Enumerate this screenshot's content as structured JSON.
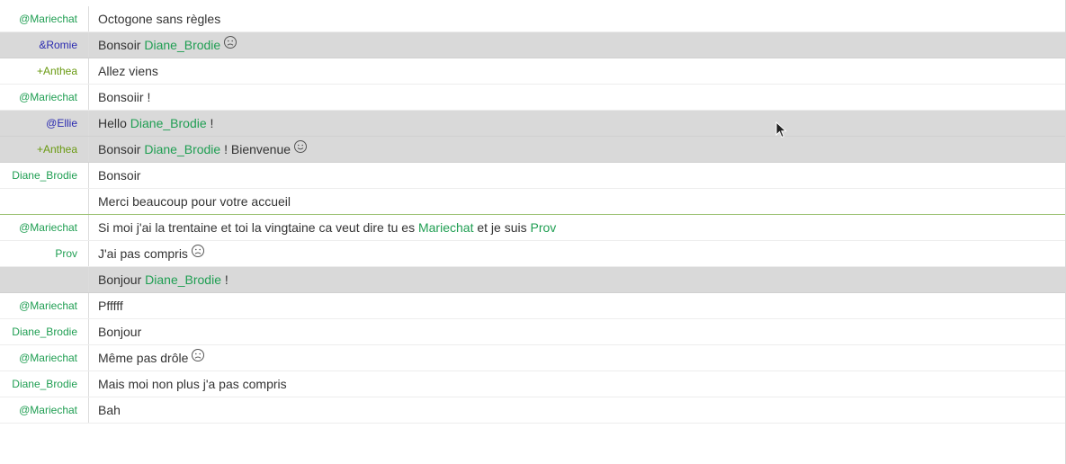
{
  "messages": [
    {
      "nick": "@Mariechat",
      "nick_color": "#1f9e52",
      "highlight": false,
      "parts": [
        {
          "t": "Octogone sans règles"
        }
      ]
    },
    {
      "nick": "&Romie",
      "nick_color": "#2a2ab0",
      "highlight": true,
      "parts": [
        {
          "t": "Bonsoir "
        },
        {
          "t": "Diane_Brodie",
          "hl": true
        }
      ],
      "smiley": "sad-smiley-icon"
    },
    {
      "nick": "+Anthea",
      "nick_color": "#6a9a12",
      "highlight": false,
      "parts": [
        {
          "t": "Allez viens"
        }
      ]
    },
    {
      "nick": "@Mariechat",
      "nick_color": "#1f9e52",
      "highlight": false,
      "parts": [
        {
          "t": "Bonsoiir !"
        }
      ]
    },
    {
      "nick": "@Ellie",
      "nick_color": "#2a2ab0",
      "highlight": true,
      "parts": [
        {
          "t": "Hello "
        },
        {
          "t": "Diane_Brodie",
          "hl": true
        },
        {
          "t": " !"
        }
      ]
    },
    {
      "nick": "+Anthea",
      "nick_color": "#6a9a12",
      "highlight": true,
      "parts": [
        {
          "t": "Bonsoir "
        },
        {
          "t": "Diane_Brodie",
          "hl": true
        },
        {
          "t": " ! Bienvenue"
        }
      ],
      "smiley": "happy-smiley-icon"
    },
    {
      "nick": "Diane_Brodie",
      "nick_color": "#1f9e52",
      "highlight": false,
      "parts": [
        {
          "t": "Bonsoir"
        }
      ]
    },
    {
      "nick": "",
      "nick_color": "#1f9e52",
      "highlight": false,
      "marker": true,
      "parts": [
        {
          "t": "Merci beaucoup pour votre accueil"
        }
      ]
    },
    {
      "nick": "@Mariechat",
      "nick_color": "#1f9e52",
      "highlight": false,
      "parts": [
        {
          "t": "Si moi j'ai la trentaine et toi la vingtaine ca veut dire tu es "
        },
        {
          "t": "Mariechat",
          "hl": true
        },
        {
          "t": " et je suis "
        },
        {
          "t": "Prov",
          "hl": true
        }
      ]
    },
    {
      "nick": "Prov",
      "nick_color": "#1f9e52",
      "highlight": false,
      "parts": [
        {
          "t": "J'ai pas compris"
        }
      ],
      "smiley": "sad-smiley-icon"
    },
    {
      "nick": "",
      "nick_color": "#1f9e52",
      "highlight": true,
      "parts": [
        {
          "t": "Bonjour "
        },
        {
          "t": "Diane_Brodie",
          "hl": true
        },
        {
          "t": " !"
        }
      ]
    },
    {
      "nick": "@Mariechat",
      "nick_color": "#1f9e52",
      "highlight": false,
      "parts": [
        {
          "t": "Pfffff"
        }
      ]
    },
    {
      "nick": "Diane_Brodie",
      "nick_color": "#1f9e52",
      "highlight": false,
      "parts": [
        {
          "t": "Bonjour"
        }
      ]
    },
    {
      "nick": "@Mariechat",
      "nick_color": "#1f9e52",
      "highlight": false,
      "parts": [
        {
          "t": "Même pas drôle"
        }
      ],
      "smiley": "sad-smiley-icon"
    },
    {
      "nick": "Diane_Brodie",
      "nick_color": "#1f9e52",
      "highlight": false,
      "parts": [
        {
          "t": "Mais moi non plus j'a pas compris"
        }
      ]
    },
    {
      "nick": "@Mariechat",
      "nick_color": "#1f9e52",
      "highlight": false,
      "parts": [
        {
          "t": "Bah"
        }
      ]
    }
  ],
  "colors": {
    "mention": "#1f9e52",
    "highlight_row": "#d9d9d9",
    "unread_marker": "#9cc274"
  },
  "cursor_icon": "mouse-pointer-icon"
}
